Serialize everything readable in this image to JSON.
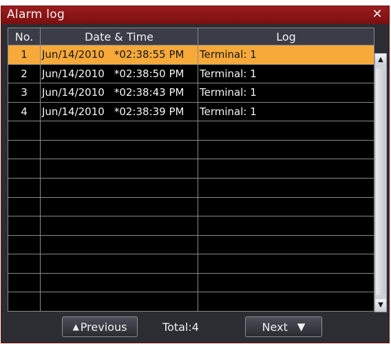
{
  "window": {
    "title": "Alarm log",
    "close_glyph": "✕"
  },
  "table": {
    "headers": {
      "no": "No.",
      "datetime": "Date & Time",
      "log": "Log"
    },
    "rows": [
      {
        "no": "1",
        "date": "Jun/14/2010",
        "time": "*02:38:55 PM",
        "log": "Terminal: 1"
      },
      {
        "no": "2",
        "date": "Jun/14/2010",
        "time": "*02:38:50 PM",
        "log": "Terminal: 1"
      },
      {
        "no": "3",
        "date": "Jun/14/2010",
        "time": "*02:38:43 PM",
        "log": "Terminal: 1"
      },
      {
        "no": "4",
        "date": "Jun/14/2010",
        "time": "*02:38:39 PM",
        "log": "Terminal: 1"
      }
    ],
    "selected_row": 1
  },
  "footer": {
    "previous_label": "Previous",
    "previous_icon": "triangle-up",
    "total_label": "Total:4",
    "next_label": "Next",
    "next_icon": "triangle-down"
  },
  "colors": {
    "title_bar": "#8a1414",
    "selected_row": "#f7a93a",
    "background": "#2b2d32"
  }
}
